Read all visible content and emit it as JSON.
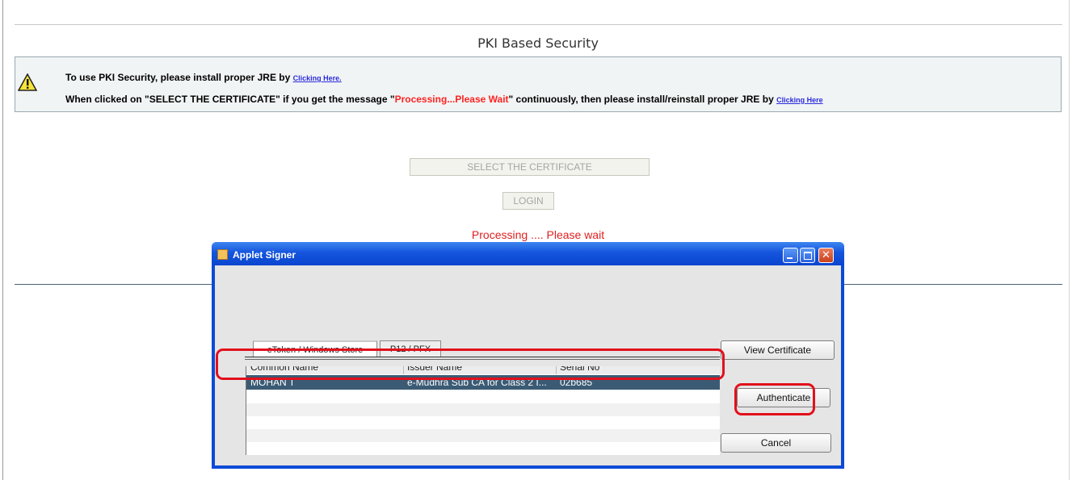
{
  "page": {
    "title": "PKI Based Security",
    "notice": {
      "line1_text": "To use PKI Security, please install proper JRE by",
      "line1_link": "Clicking Here.",
      "line2_text_a": "When clicked on \"SELECT THE CERTIFICATE\" if you get the message \"",
      "line2_text_red": "Processing...Please Wait",
      "line2_text_b": "\" continuously, then please install/reinstall proper JRE by",
      "line2_link": "Clicking Here"
    },
    "select_button": "SELECT THE CERTIFICATE",
    "login_button": "LOGIN",
    "processing_text": "Processing .... Please wait"
  },
  "dialog": {
    "title": "Applet Signer",
    "tabs": [
      {
        "label": "eToken / Windows Store",
        "active": true
      },
      {
        "label": "P12 / PFX",
        "active": false
      }
    ],
    "columns": [
      "Common Name",
      "Issuer Name",
      "Serial No"
    ],
    "rows": [
      {
        "common_name": "MOHAN T",
        "issuer_name": "e-Mudhra Sub CA for Class 2 I...",
        "serial_no": "02b685",
        "selected": true
      }
    ],
    "buttons": {
      "view": "View Certificate",
      "authenticate": "Authenticate",
      "cancel": "Cancel"
    }
  },
  "colors": {
    "highlight": "#e2101c",
    "selected_row": "#3b5b74",
    "title_bar": "#1554dd",
    "processing_text": "#e02020"
  }
}
